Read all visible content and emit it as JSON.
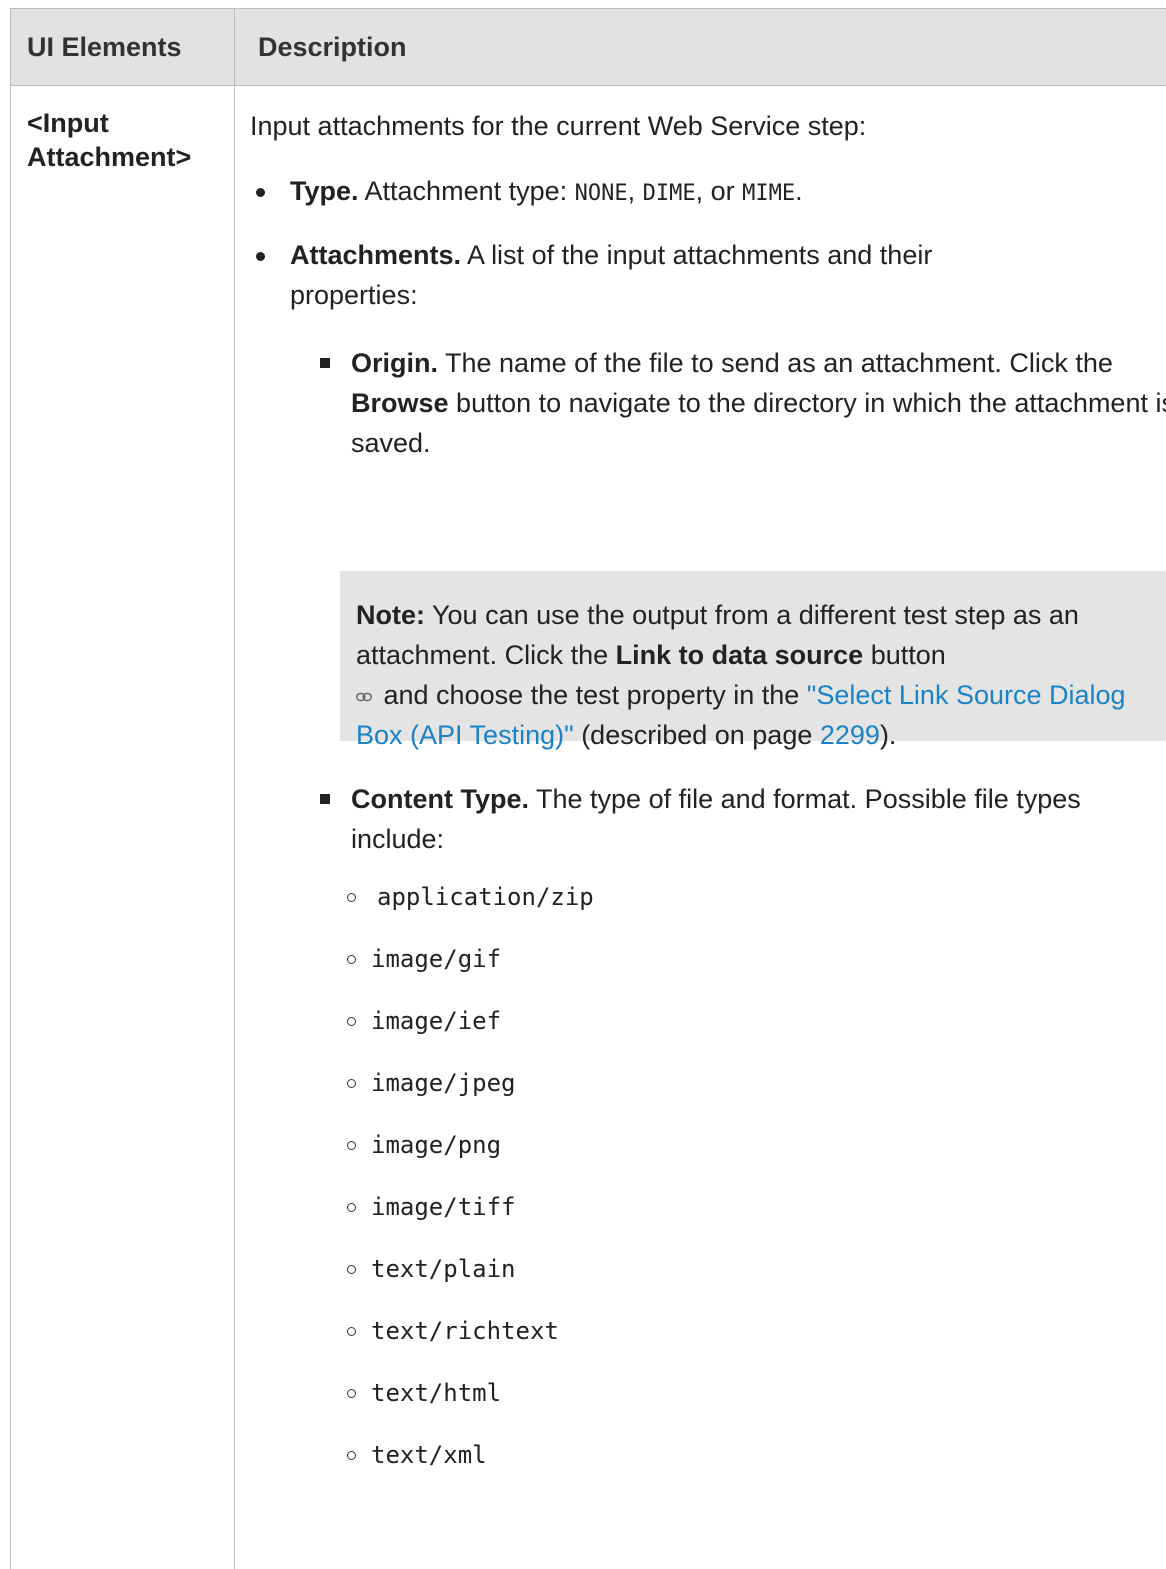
{
  "table": {
    "header": {
      "col1": "UI Elements",
      "col2": "Description"
    },
    "row": {
      "element_line1": "<Input",
      "element_line2": "Attachment>",
      "intro": "Input attachments for the current Web Service step:",
      "type_item": {
        "label": "Type.",
        "text_a": " Attachment type: ",
        "code_none": "NONE",
        "sep1": ", ",
        "code_dime": "DIME",
        "sep2": ", or ",
        "code_mime": "MIME",
        "end": "."
      },
      "attachments_item": {
        "label": "Attachments.",
        "text": " A list of the input attachments and their properties:"
      },
      "origin_item": {
        "label": "Origin.",
        "text_a": " The name of the file to send as an attachment. Click the ",
        "browse": "Browse",
        "text_b": " button to navigate to the directory in which the attachment is saved."
      },
      "note": {
        "label": "Note:",
        "text_a": " You can use the output from a different test step as an attachment. Click the ",
        "link_label": "Link to data source",
        "text_b": " button ",
        "icon": "link-icon",
        "text_c": " and choose the test property in the ",
        "link_text": "\"Select Link Source Dialog Box (API Testing)\"",
        "text_d": " (described on page ",
        "page_link": "2299",
        "text_e": ")."
      },
      "content_type_item": {
        "label": "Content Type.",
        "text": " The type of file and format. Possible file types include:"
      },
      "content_types": [
        "application/zip",
        "image/gif",
        "image/ief",
        "image/jpeg",
        "image/png",
        "image/tiff",
        "text/plain",
        "text/richtext",
        "text/html",
        "text/xml"
      ]
    }
  },
  "colors": {
    "header_bg": "#e2e2e2",
    "note_bg": "#e4e4e4",
    "link": "#1a82c6"
  }
}
